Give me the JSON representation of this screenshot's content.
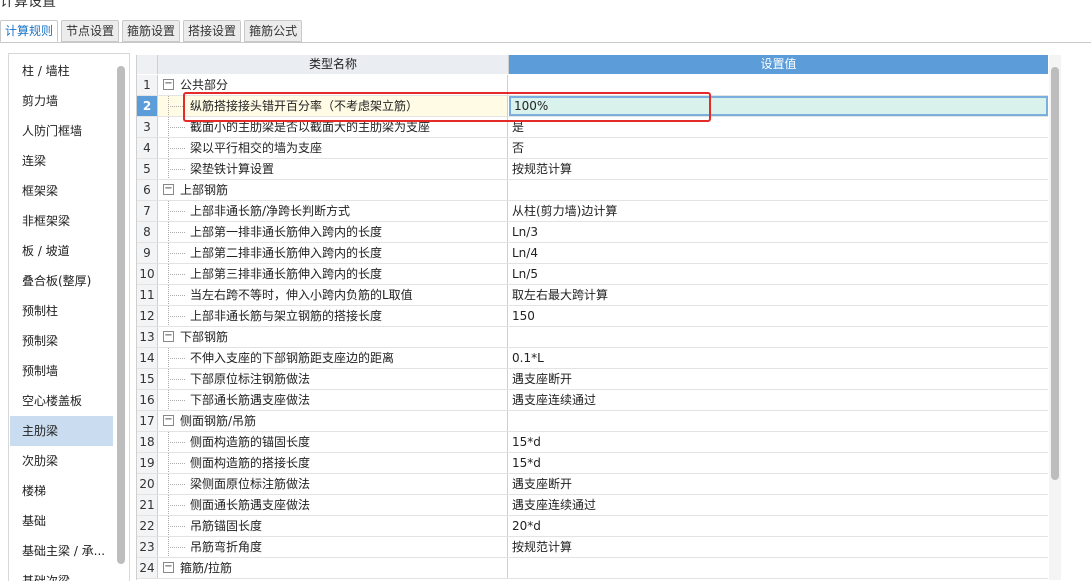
{
  "tabs": [
    "计算规则",
    "节点设置",
    "箍筋设置",
    "搭接设置",
    "箍筋公式"
  ],
  "active_tab": 0,
  "sidebar": {
    "items": [
      "柱 / 墙柱",
      "剪力墙",
      "人防门框墙",
      "连梁",
      "框架梁",
      "非框架梁",
      "板 / 坡道",
      "叠合板(整厚)",
      "预制柱",
      "预制梁",
      "预制墙",
      "空心楼盖板",
      "主肋梁",
      "次肋梁",
      "楼梯",
      "基础",
      "基础主梁 / 承...",
      "基础次梁"
    ],
    "selected": 12
  },
  "grid": {
    "col_name": "类型名称",
    "col_value": "设置值",
    "current_row": 2,
    "rows": [
      {
        "num": "1",
        "cat": true,
        "name": "公共部分",
        "value": ""
      },
      {
        "num": "2",
        "cat": false,
        "name": "纵筋搭接接头错开百分率（不考虑架立筋）",
        "value": "100%"
      },
      {
        "num": "3",
        "cat": false,
        "name": "截面小的主肋梁是否以截面大的主肋梁为支座",
        "value": "是"
      },
      {
        "num": "4",
        "cat": false,
        "name": "梁以平行相交的墙为支座",
        "value": "否"
      },
      {
        "num": "5",
        "cat": false,
        "name": "梁垫铁计算设置",
        "value": "按规范计算"
      },
      {
        "num": "6",
        "cat": true,
        "name": "上部钢筋",
        "value": ""
      },
      {
        "num": "7",
        "cat": false,
        "name": "上部非通长筋/净跨长判断方式",
        "value": "从柱(剪力墙)边计算"
      },
      {
        "num": "8",
        "cat": false,
        "name": "上部第一排非通长筋伸入跨内的长度",
        "value": "Ln/3"
      },
      {
        "num": "9",
        "cat": false,
        "name": "上部第二排非通长筋伸入跨内的长度",
        "value": "Ln/4"
      },
      {
        "num": "10",
        "cat": false,
        "name": "上部第三排非通长筋伸入跨内的长度",
        "value": "Ln/5"
      },
      {
        "num": "11",
        "cat": false,
        "name": "当左右跨不等时，伸入小跨内负筋的L取值",
        "value": "取左右最大跨计算"
      },
      {
        "num": "12",
        "cat": false,
        "name": "上部非通长筋与架立钢筋的搭接长度",
        "value": "150"
      },
      {
        "num": "13",
        "cat": true,
        "name": "下部钢筋",
        "value": ""
      },
      {
        "num": "14",
        "cat": false,
        "name": "不伸入支座的下部钢筋距支座边的距离",
        "value": "0.1*L"
      },
      {
        "num": "15",
        "cat": false,
        "name": "下部原位标注钢筋做法",
        "value": "遇支座断开"
      },
      {
        "num": "16",
        "cat": false,
        "name": "下部通长筋遇支座做法",
        "value": "遇支座连续通过"
      },
      {
        "num": "17",
        "cat": true,
        "name": "侧面钢筋/吊筋",
        "value": ""
      },
      {
        "num": "18",
        "cat": false,
        "name": "侧面构造筋的锚固长度",
        "value": "15*d"
      },
      {
        "num": "19",
        "cat": false,
        "name": "侧面构造筋的搭接长度",
        "value": "15*d"
      },
      {
        "num": "20",
        "cat": false,
        "name": "梁侧面原位标注筋做法",
        "value": "遇支座断开"
      },
      {
        "num": "21",
        "cat": false,
        "name": "侧面通长筋遇支座做法",
        "value": "遇支座连续通过"
      },
      {
        "num": "22",
        "cat": false,
        "name": "吊筋锚固长度",
        "value": "20*d"
      },
      {
        "num": "23",
        "cat": false,
        "name": "吊筋弯折角度",
        "value": "按规范计算"
      },
      {
        "num": "24",
        "cat": true,
        "name": "箍筋/拉筋",
        "value": ""
      }
    ]
  },
  "icons": {
    "expand": "minus-box-icon"
  },
  "colors": {
    "accent": "#5b9cd9",
    "highlight": "#e52a2a",
    "current_value_bg": "#d9f2ec",
    "current_name_bg": "#fffbe5"
  }
}
